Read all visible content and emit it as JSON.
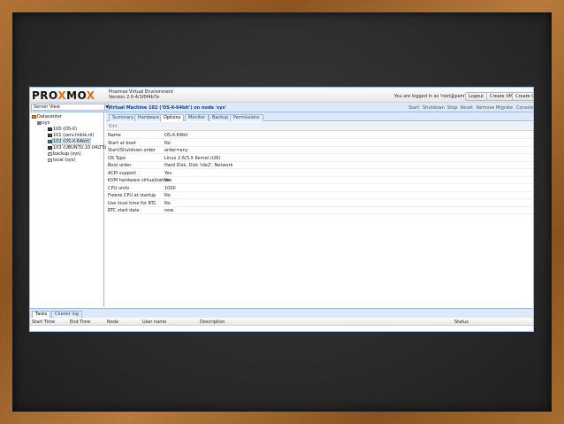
{
  "header": {
    "logo_left": "PRO",
    "logo_x": "X",
    "logo_right": "MO",
    "logo_x2": "X",
    "title_line1": "Proxmox Virtual Environment",
    "title_line2": "Version 2.0-4/1f0f4b7e",
    "logged_in_text": "You are logged in as 'root@pam'",
    "logout_label": "Logout",
    "create_vm_label": "Create VM",
    "create_ct_label": "Create CT"
  },
  "toolbar": {
    "view_select_value": "Server View",
    "vm_title": "Virtual Machine 102 ('OS-X-64bit') on node 'sys'",
    "actions": [
      "Start",
      "Shutdown",
      "Stop",
      "Reset",
      "Remove",
      "Migrate",
      "Console"
    ]
  },
  "tree": {
    "items": [
      {
        "label": "Datacenter",
        "icon": "datacenter-icon"
      },
      {
        "label": "sys",
        "icon": "node-icon"
      },
      {
        "label": "100 (OS-X)",
        "icon": "vm-icon"
      },
      {
        "label": "101 (serv.linkle.nl)",
        "icon": "vm-icon"
      },
      {
        "label": "102 (OS-X-64bit)",
        "icon": "vm-icon"
      },
      {
        "label": "103 (UBUNTU.10.04LTS)",
        "icon": "vm-icon"
      },
      {
        "label": "backup (sys)",
        "icon": "storage-icon"
      },
      {
        "label": "local (sys)",
        "icon": "storage-icon"
      }
    ]
  },
  "tabs": [
    "Summary",
    "Hardware",
    "Options",
    "Monitor",
    "Backup",
    "Permissions"
  ],
  "active_tab": "Options",
  "edit_label": "Edit",
  "options": [
    {
      "key": "Name",
      "value": "OS-X-64bit"
    },
    {
      "key": "Start at boot",
      "value": "No"
    },
    {
      "key": "Start/Shutdown order",
      "value": "order=any"
    },
    {
      "key": "OS Type",
      "value": "Linux 2.6/3.X Kernel (l26)"
    },
    {
      "key": "Boot order",
      "value": "Hard Disk, Disk 'ide2', Network"
    },
    {
      "key": "ACPI support",
      "value": "Yes"
    },
    {
      "key": "KVM hardware virtualization",
      "value": "Yes"
    },
    {
      "key": "CPU units",
      "value": "1000"
    },
    {
      "key": "Freeze CPU at startup",
      "value": "No"
    },
    {
      "key": "Use local time for RTC",
      "value": "No"
    },
    {
      "key": "RTC start date",
      "value": "now"
    }
  ],
  "bottom": {
    "tabs": [
      "Tasks",
      "Cluster log"
    ],
    "columns": [
      "Start Time",
      "End Time",
      "Node",
      "User name",
      "Description",
      "Status"
    ]
  }
}
